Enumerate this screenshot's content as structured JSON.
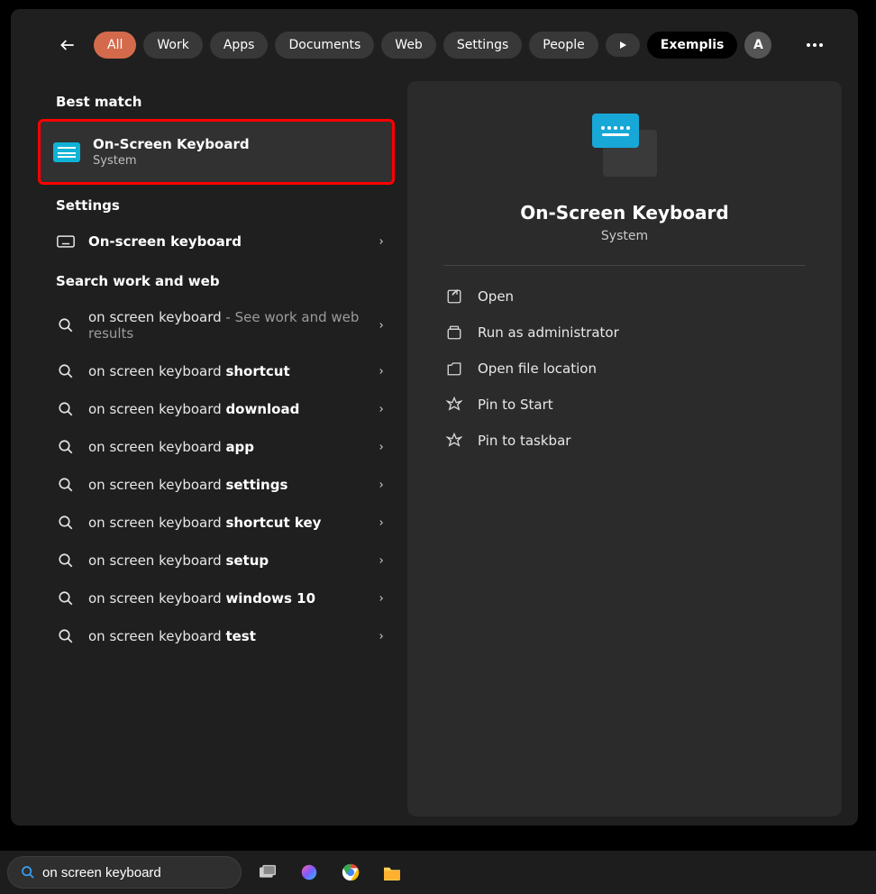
{
  "filters": {
    "items": [
      "All",
      "Work",
      "Apps",
      "Documents",
      "Web",
      "Settings",
      "People"
    ],
    "active_index": 0,
    "x_label": "Exemplis",
    "avatar_initial": "A"
  },
  "sections": {
    "best_match": "Best match",
    "settings": "Settings",
    "search_web": "Search work and web"
  },
  "best_match": {
    "title": "On-Screen Keyboard",
    "subtitle": "System"
  },
  "settings_row": {
    "label": "On-screen keyboard"
  },
  "suggestions": [
    {
      "prefix": "on screen keyboard",
      "bold": "",
      "hint": " - See work and web results"
    },
    {
      "prefix": "on screen keyboard ",
      "bold": "shortcut",
      "hint": ""
    },
    {
      "prefix": "on screen keyboard ",
      "bold": "download",
      "hint": ""
    },
    {
      "prefix": "on screen keyboard ",
      "bold": "app",
      "hint": ""
    },
    {
      "prefix": "on screen keyboard ",
      "bold": "settings",
      "hint": ""
    },
    {
      "prefix": "on screen keyboard ",
      "bold": "shortcut key",
      "hint": ""
    },
    {
      "prefix": "on screen keyboard ",
      "bold": "setup",
      "hint": ""
    },
    {
      "prefix": "on screen keyboard ",
      "bold": "windows 10",
      "hint": ""
    },
    {
      "prefix": "on screen keyboard ",
      "bold": "test",
      "hint": ""
    }
  ],
  "preview": {
    "title": "On-Screen Keyboard",
    "subtitle": "System",
    "actions": [
      "Open",
      "Run as administrator",
      "Open file location",
      "Pin to Start",
      "Pin to taskbar"
    ]
  },
  "taskbar": {
    "search_value": "on screen keyboard"
  }
}
